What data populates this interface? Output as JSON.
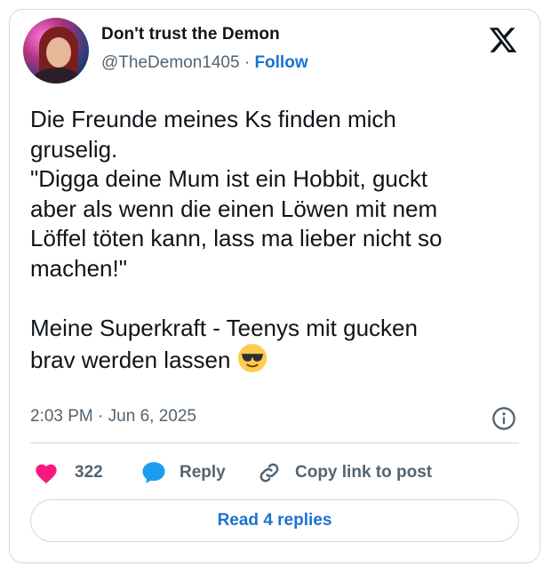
{
  "author": {
    "display_name": "Don't trust the Demon",
    "handle": "@TheDemon1405",
    "separator": "·",
    "follow_label": "Follow"
  },
  "tweet": {
    "lines": [
      "Die Freunde meines Ks finden mich",
      "gruselig.",
      "\"Digga deine Mum ist ein Hobbit, guckt",
      "aber als wenn die einen Löwen mit nem",
      "Löffel töten kann, lass ma lieber nicht so",
      "machen!\"",
      "",
      "Meine Superkraft - Teenys mit gucken",
      "brav werden lassen"
    ],
    "emoji": "smiling-face-with-sunglasses"
  },
  "meta": {
    "time": "2:03 PM",
    "separator": "·",
    "date": "Jun 6, 2025"
  },
  "actions": {
    "likes_count": "322",
    "reply_label": "Reply",
    "copy_label": "Copy link to post"
  },
  "read_replies_label": "Read 4 replies",
  "colors": {
    "accent": "#1d72d0",
    "heart": "#f91880",
    "reply_bubble": "#1d9bf0",
    "muted": "#536471",
    "border": "#cfd9de"
  }
}
